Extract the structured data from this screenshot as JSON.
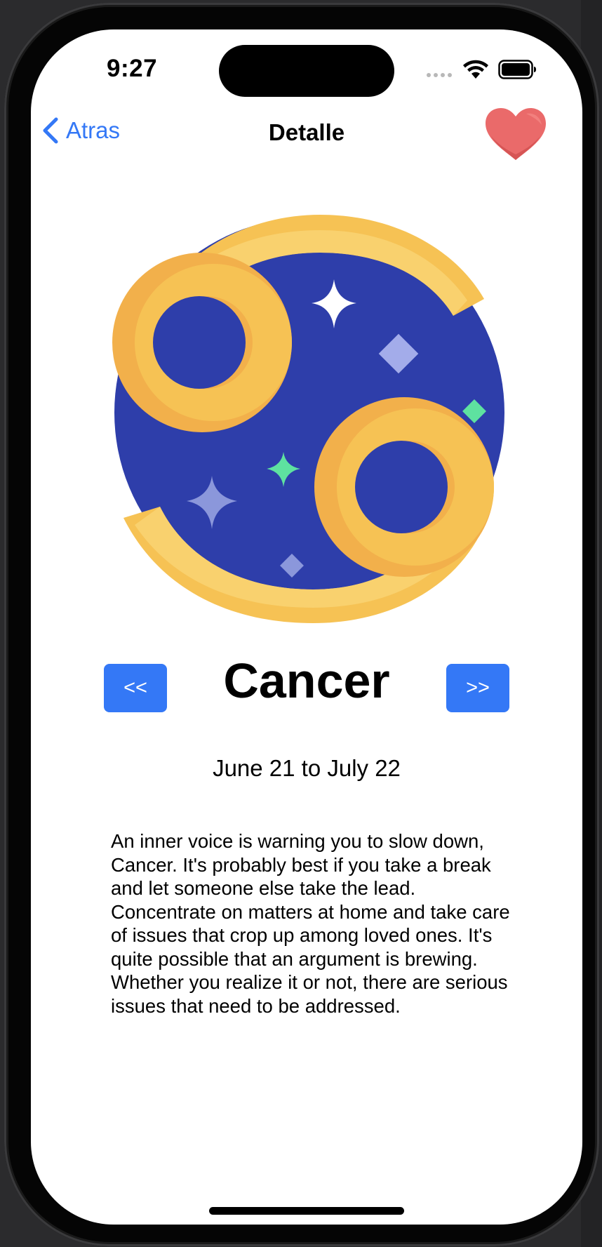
{
  "status_bar": {
    "time": "9:27"
  },
  "nav": {
    "back_label": "Atras",
    "title": "Detalle",
    "favorite_icon": "heart-icon"
  },
  "sign": {
    "name": "Cancer",
    "date_range": "June 21 to July 22",
    "prev_label": "<<",
    "next_label": ">>",
    "description": "An inner voice is warning you to slow down, Cancer. It's probably best if you take a break and let someone else take the lead. Concentrate on matters at home and take care of issues that crop up among loved ones. It's quite possible that an argument is brewing. Whether you realize it or not, there are serious issues that need to be addressed."
  },
  "colors": {
    "accent": "#3478f6",
    "heart": "#ea6a6a",
    "zodiac_blue": "#2e3eaa",
    "zodiac_gold": "#f5bb52"
  }
}
